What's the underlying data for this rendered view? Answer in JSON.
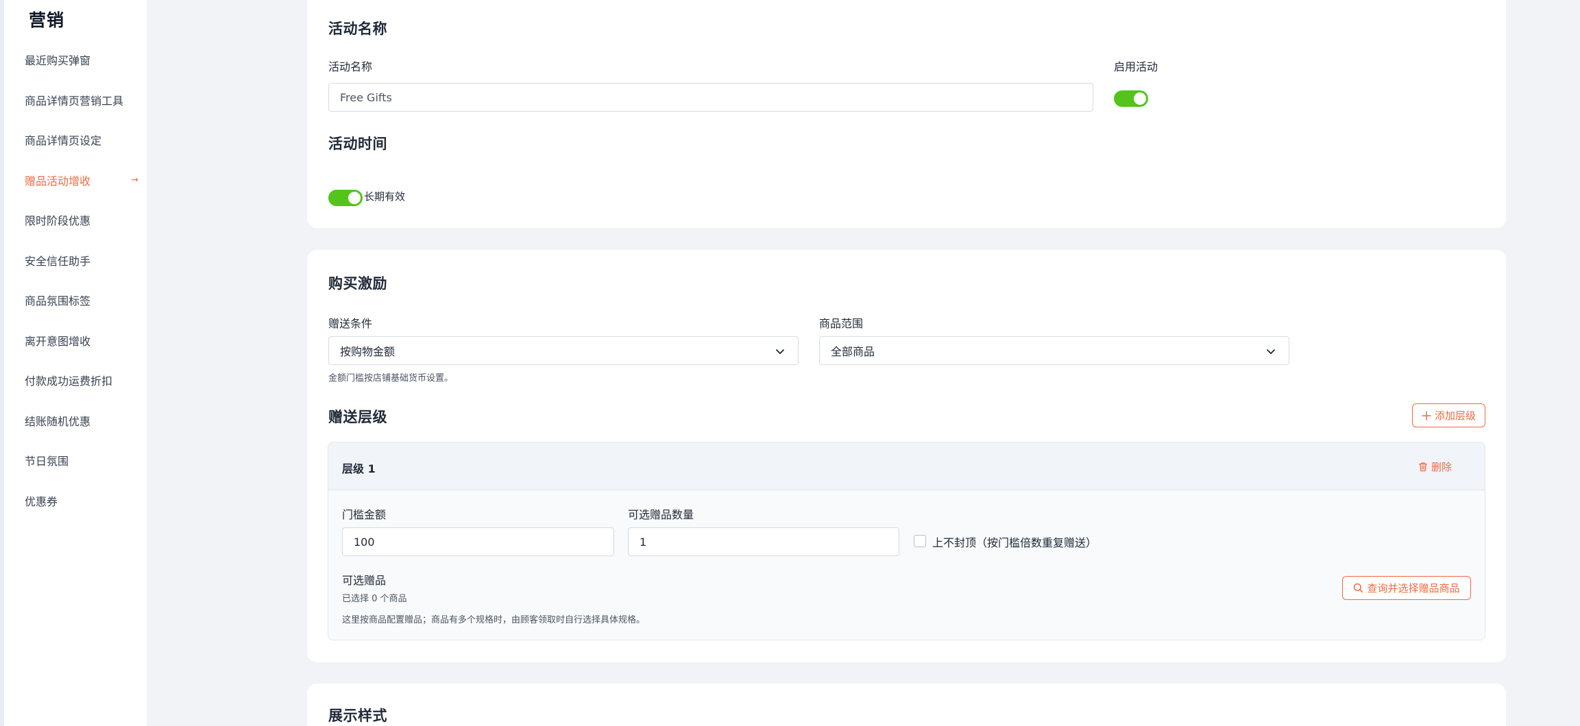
{
  "sidebar": {
    "title": "营销",
    "items": [
      {
        "label": "最近购买弹窗",
        "active": false
      },
      {
        "label": "商品详情页营销工具",
        "active": false
      },
      {
        "label": "商品详情页设定",
        "active": false
      },
      {
        "label": "赠品活动增收",
        "active": true
      },
      {
        "label": "限时阶段优惠",
        "active": false
      },
      {
        "label": "安全信任助手",
        "active": false
      },
      {
        "label": "商品氛围标签",
        "active": false
      },
      {
        "label": "离开意图增收",
        "active": false
      },
      {
        "label": "付款成功运费折扣",
        "active": false
      },
      {
        "label": "结账随机优惠",
        "active": false
      },
      {
        "label": "节日氛围",
        "active": false
      },
      {
        "label": "优惠券",
        "active": false
      }
    ],
    "active_arrow": "→"
  },
  "activity": {
    "section_title": "活动名称",
    "name_label": "活动名称",
    "name_value": "Free Gifts",
    "enable_label": "启用活动",
    "enable_on": true,
    "time_title": "活动时间",
    "long_term_label": "长期有效",
    "long_term_on": true
  },
  "incentive": {
    "section_title": "购买激励",
    "condition_label": "赠送条件",
    "condition_value": "按购物金额",
    "scope_label": "商品范围",
    "scope_value": "全部商品",
    "condition_hint": "金额门槛按店铺基础货币设置。",
    "tiers_title": "赠送层级",
    "add_tier_label": "添加层级",
    "tier": {
      "title": "层级 1",
      "delete_label": "删除",
      "threshold_label": "门槛金额",
      "threshold_value": "100",
      "qty_label": "可选赠品数量",
      "qty_value": "1",
      "no_cap_label": "上不封顶（按门槛倍数重复赠送）",
      "no_cap_checked": false,
      "gifts_label": "可选赠品",
      "selected_text": "已选择 0 个商品",
      "gifts_hint": "这里按商品配置赠品；商品有多个规格时，由顾客领取时自行选择具体规格。",
      "select_button": "查询并选择赠品商品"
    }
  },
  "display": {
    "section_title": "展示样式"
  },
  "colors": {
    "accent": "#f06a43",
    "toggle_on": "#52c41a"
  }
}
